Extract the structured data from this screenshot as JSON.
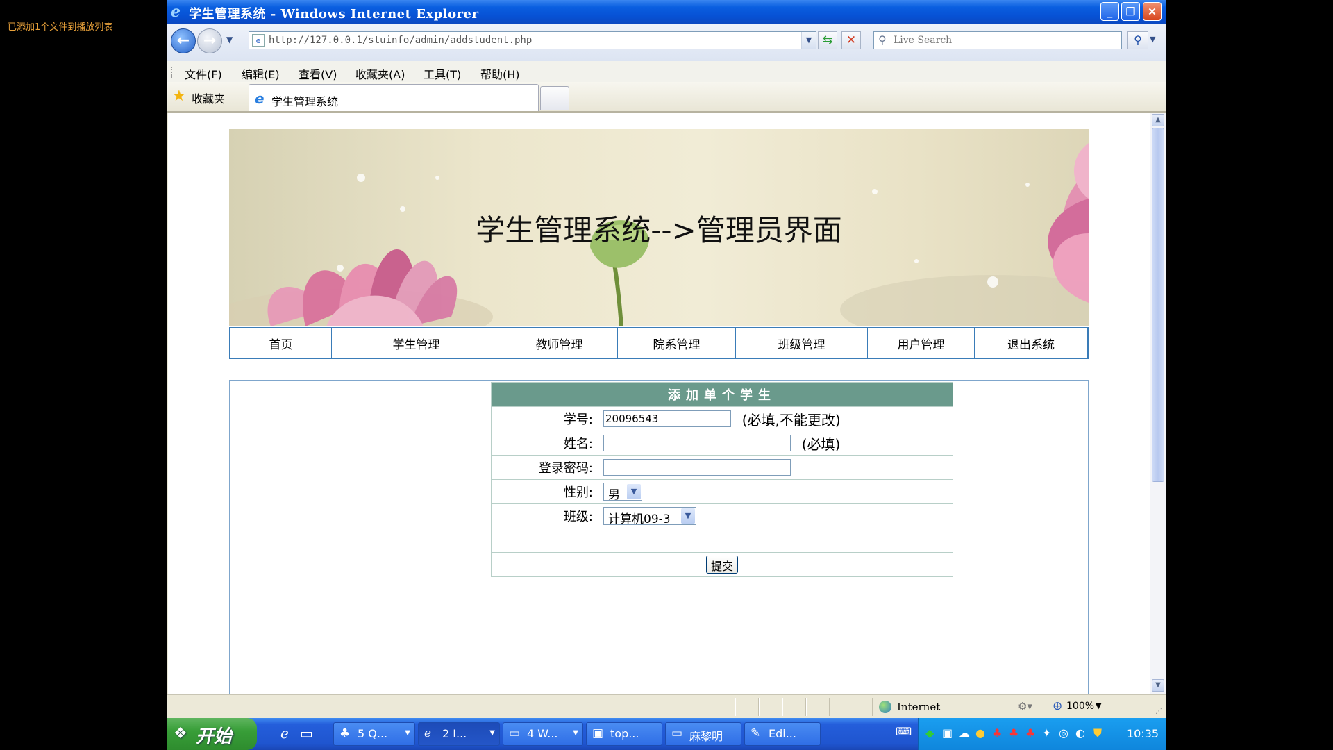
{
  "notice": "已添加1个文件到播放列表",
  "browser": {
    "title": "学生管理系统 - Windows Internet Explorer",
    "url": "http://127.0.0.1/stuinfo/admin/addstudent.php",
    "search_placeholder": "Live Search",
    "menu": [
      "文件(F)",
      "编辑(E)",
      "查看(V)",
      "收藏夹(A)",
      "工具(T)",
      "帮助(H)"
    ],
    "favorites_label": "收藏夹",
    "tab_title": "学生管理系统"
  },
  "page": {
    "banner_title": "学生管理系统-->管理员界面",
    "nav": [
      "首页",
      "学生管理",
      "教师管理",
      "院系管理",
      "班级管理",
      "用户管理",
      "退出系统"
    ],
    "form": {
      "heading": "添加单个学生",
      "student_id_label": "学号:",
      "student_id_value": "20096543",
      "student_id_note": "(必填,不能更改)",
      "name_label": "姓名:",
      "name_value": "",
      "name_note": "(必填)",
      "password_label": "登录密码:",
      "password_value": "",
      "gender_label": "性别:",
      "gender_value": "男",
      "class_label": "班级:",
      "class_value": "计算机09-3",
      "submit_label": "提交"
    }
  },
  "statusbar": {
    "zone": "Internet",
    "zoom": "100%"
  },
  "taskbar": {
    "start_label": "开始",
    "tasks": [
      {
        "label": "5 Q...",
        "icon": "qq-icon"
      },
      {
        "label": "2 I...",
        "icon": "ie-icon"
      },
      {
        "label": "4 W...",
        "icon": "folder-icon"
      },
      {
        "label": "top...",
        "icon": "fireworks-icon"
      },
      {
        "label": "麻黎明",
        "icon": "folder-icon"
      },
      {
        "label": "Edi...",
        "icon": "editor-icon"
      }
    ],
    "clock": "10:35"
  },
  "colors": {
    "titlebar": "#0a5fe0",
    "nav_border": "#3a7cb8",
    "form_header": "#6a9a8c",
    "taskbar": "#245edb",
    "start_button": "#389e38"
  }
}
